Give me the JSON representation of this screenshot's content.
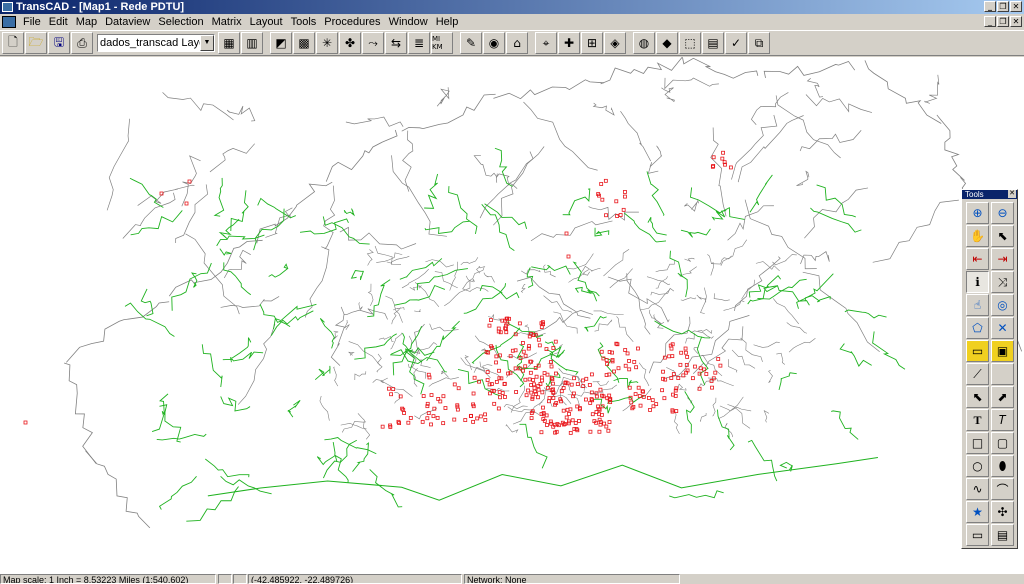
{
  "window": {
    "title": "TransCAD - [Map1 - Rede PDTU]"
  },
  "menu": [
    "File",
    "Edit",
    "Map",
    "Dataview",
    "Selection",
    "Matrix",
    "Layout",
    "Tools",
    "Procedures",
    "Window",
    "Help"
  ],
  "toolbar": {
    "layer_value": "dados_transcad Layer",
    "left_icons": [
      "new-icon",
      "open-icon",
      "save-icon",
      "print-icon"
    ],
    "right_icons": [
      "dataview-icon",
      "chart-icon",
      "highlight-icon",
      "grid-icon",
      "network-icon",
      "overlay-icon",
      "shortest-path-icon",
      "route-icon",
      "legend-icon",
      "scale-icon",
      "paint-icon",
      "palette-icon",
      "label-icon",
      "locate-icon",
      "pin-icon",
      "table-icon",
      "layer-icon",
      "globe-icon",
      "layers-icon",
      "select-icon",
      "theme-icon",
      "check-icon",
      "copy-icon"
    ],
    "scale_label": "MI KM"
  },
  "tools": {
    "title": "Tools",
    "items": [
      "zoom-in-icon",
      "zoom-out-icon",
      "pan-hand-icon",
      "select-pointer-icon",
      "previous-view-icon",
      "next-view-icon",
      "info-icon",
      "drag-icon",
      "select-point-icon",
      "select-circle-icon",
      "select-polygon-icon",
      "deselect-icon",
      "ruler-icon",
      "measure-area-icon",
      "line-tool-icon",
      "blank",
      "arrow-icon",
      "move-icon",
      "text-icon",
      "text-italic-icon",
      "rectangle-icon",
      "rounded-rect-icon",
      "circle-icon",
      "freeform-icon",
      "polyline-icon",
      "curve-icon",
      "symbol-icon",
      "compass-icon",
      "image-icon",
      "map-frame-icon"
    ]
  },
  "status": {
    "scale": "Map scale: 1 Inch = 8.53223 Miles (1:540,602)",
    "coords": "(-42.485922, -22.489726)",
    "network": "Network: None"
  },
  "colors": {
    "boundary": "#808080",
    "network": "#1fb21f",
    "points": "#e8161b"
  }
}
